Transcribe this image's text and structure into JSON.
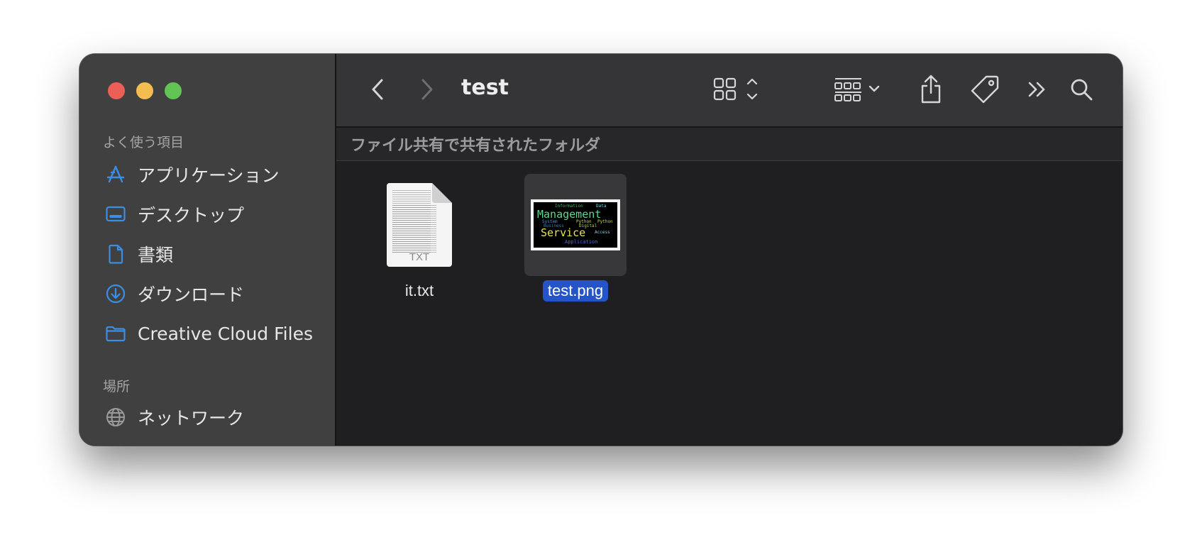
{
  "window": {
    "traffic_lights": {
      "close": "#ec5f57",
      "minimize": "#f4bd4f",
      "zoom": "#61c454"
    }
  },
  "sidebar": {
    "favorites_title": "よく使う項目",
    "items": [
      {
        "label": "アプリケーション",
        "icon": "applications-icon"
      },
      {
        "label": "デスクトップ",
        "icon": "desktop-icon"
      },
      {
        "label": "書類",
        "icon": "document-icon"
      },
      {
        "label": "ダウンロード",
        "icon": "download-icon"
      },
      {
        "label": "Creative Cloud Files",
        "icon": "folder-icon"
      }
    ],
    "locations_title": "場所",
    "locations": [
      {
        "label": "ネットワーク",
        "icon": "network-icon"
      }
    ],
    "accent": "#3b8ee6"
  },
  "toolbar": {
    "title": "test",
    "icons": [
      "back-icon",
      "forward-icon",
      "grid-view-icon",
      "group-icon",
      "share-icon",
      "tag-icon",
      "more-icon",
      "search-icon"
    ]
  },
  "pathbar": {
    "label": "ファイル共有で共有されたフォルダ"
  },
  "files": [
    {
      "name": "it.txt",
      "type": "txt",
      "badge": "TXT",
      "selected": false
    },
    {
      "name": "test.png",
      "type": "png",
      "selected": true,
      "thumbnail_words": [
        "Management",
        "Service",
        "Information",
        "Data",
        "System",
        "Python",
        "Business",
        "Digital",
        "Application",
        "Access",
        "Python"
      ]
    }
  ],
  "selection_color": "#2454c8"
}
